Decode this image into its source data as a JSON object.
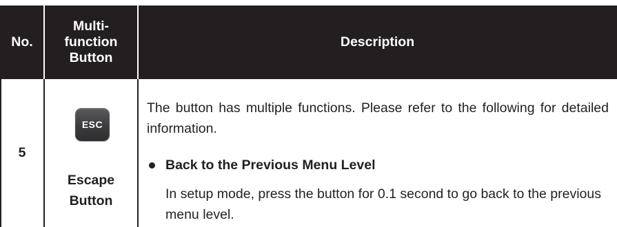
{
  "table": {
    "headers": {
      "no": "No.",
      "button": [
        "Multi-",
        "function",
        "Button"
      ],
      "description": "Description"
    },
    "rows": [
      {
        "no": "5",
        "key_label": "ESC",
        "button_name": [
          "Escape",
          "Button"
        ],
        "description": {
          "intro": "The button has multiple functions. Please refer to the following for detailed information.",
          "items": [
            {
              "heading": "Back to the Previous Menu Level",
              "text": "In setup mode, press the button for 0.1 second to go back to the previous menu level."
            }
          ]
        }
      }
    ]
  },
  "colors": {
    "header_bg": "#231f20",
    "header_text": "#ffffff",
    "body_text": "#231f20",
    "key_face": "#3c3c3e"
  }
}
